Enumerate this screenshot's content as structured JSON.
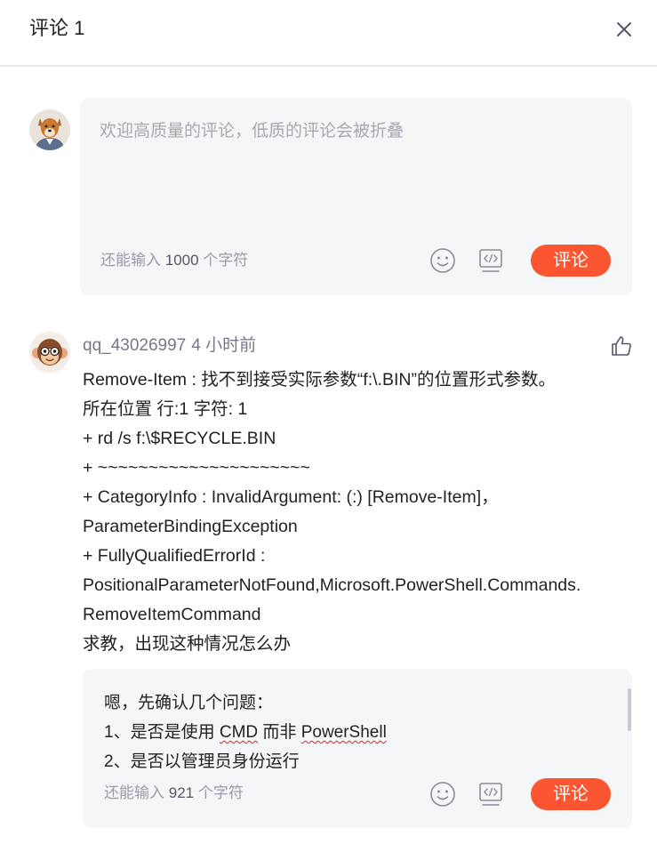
{
  "header": {
    "title": "评论 1",
    "close_icon": "close-icon"
  },
  "composer": {
    "placeholder": "欢迎高质量的评论，低质的评论会被折叠",
    "counter_prefix": "还能输入",
    "counter_value": "1000",
    "counter_suffix": "个字符",
    "emoji_icon": "emoji-icon",
    "code_icon": "code-icon",
    "submit_label": "评论"
  },
  "comment": {
    "username": "qq_43026997",
    "time": "4 小时前",
    "like_icon": "thumbs-up-icon",
    "lines": [
      "Remove-Item : 找不到接受实际参数“f:\\.BIN”的位置形式参数。",
      "所在位置 行:1 字符: 1",
      "+ rd /s f:\\$RECYCLE.BIN",
      "+ ~~~~~~~~~~~~~~~~~~~~~",
      "+ CategoryInfo : InvalidArgument: (:) [Remove-Item]，",
      "ParameterBindingException",
      "+ FullyQualifiedErrorId :",
      "PositionalParameterNotFound,Microsoft.PowerShell.Commands.",
      "RemoveItemCommand",
      "求教，出现这种情况怎么办"
    ]
  },
  "reply": {
    "line1": "嗯，先确认几个问题：",
    "line2_a": "1、是否是使用 ",
    "line2_cmd": "CMD",
    "line2_b": " 而非 ",
    "line2_ps": "PowerShell",
    "line3": "2、是否以管理员身份运行",
    "counter_prefix": "还能输入",
    "counter_value": "921",
    "counter_suffix": "个字符",
    "submit_label": "评论"
  },
  "colors": {
    "accent": "#fc5531",
    "panel": "#f5f6f7",
    "muted": "#999aaa"
  }
}
